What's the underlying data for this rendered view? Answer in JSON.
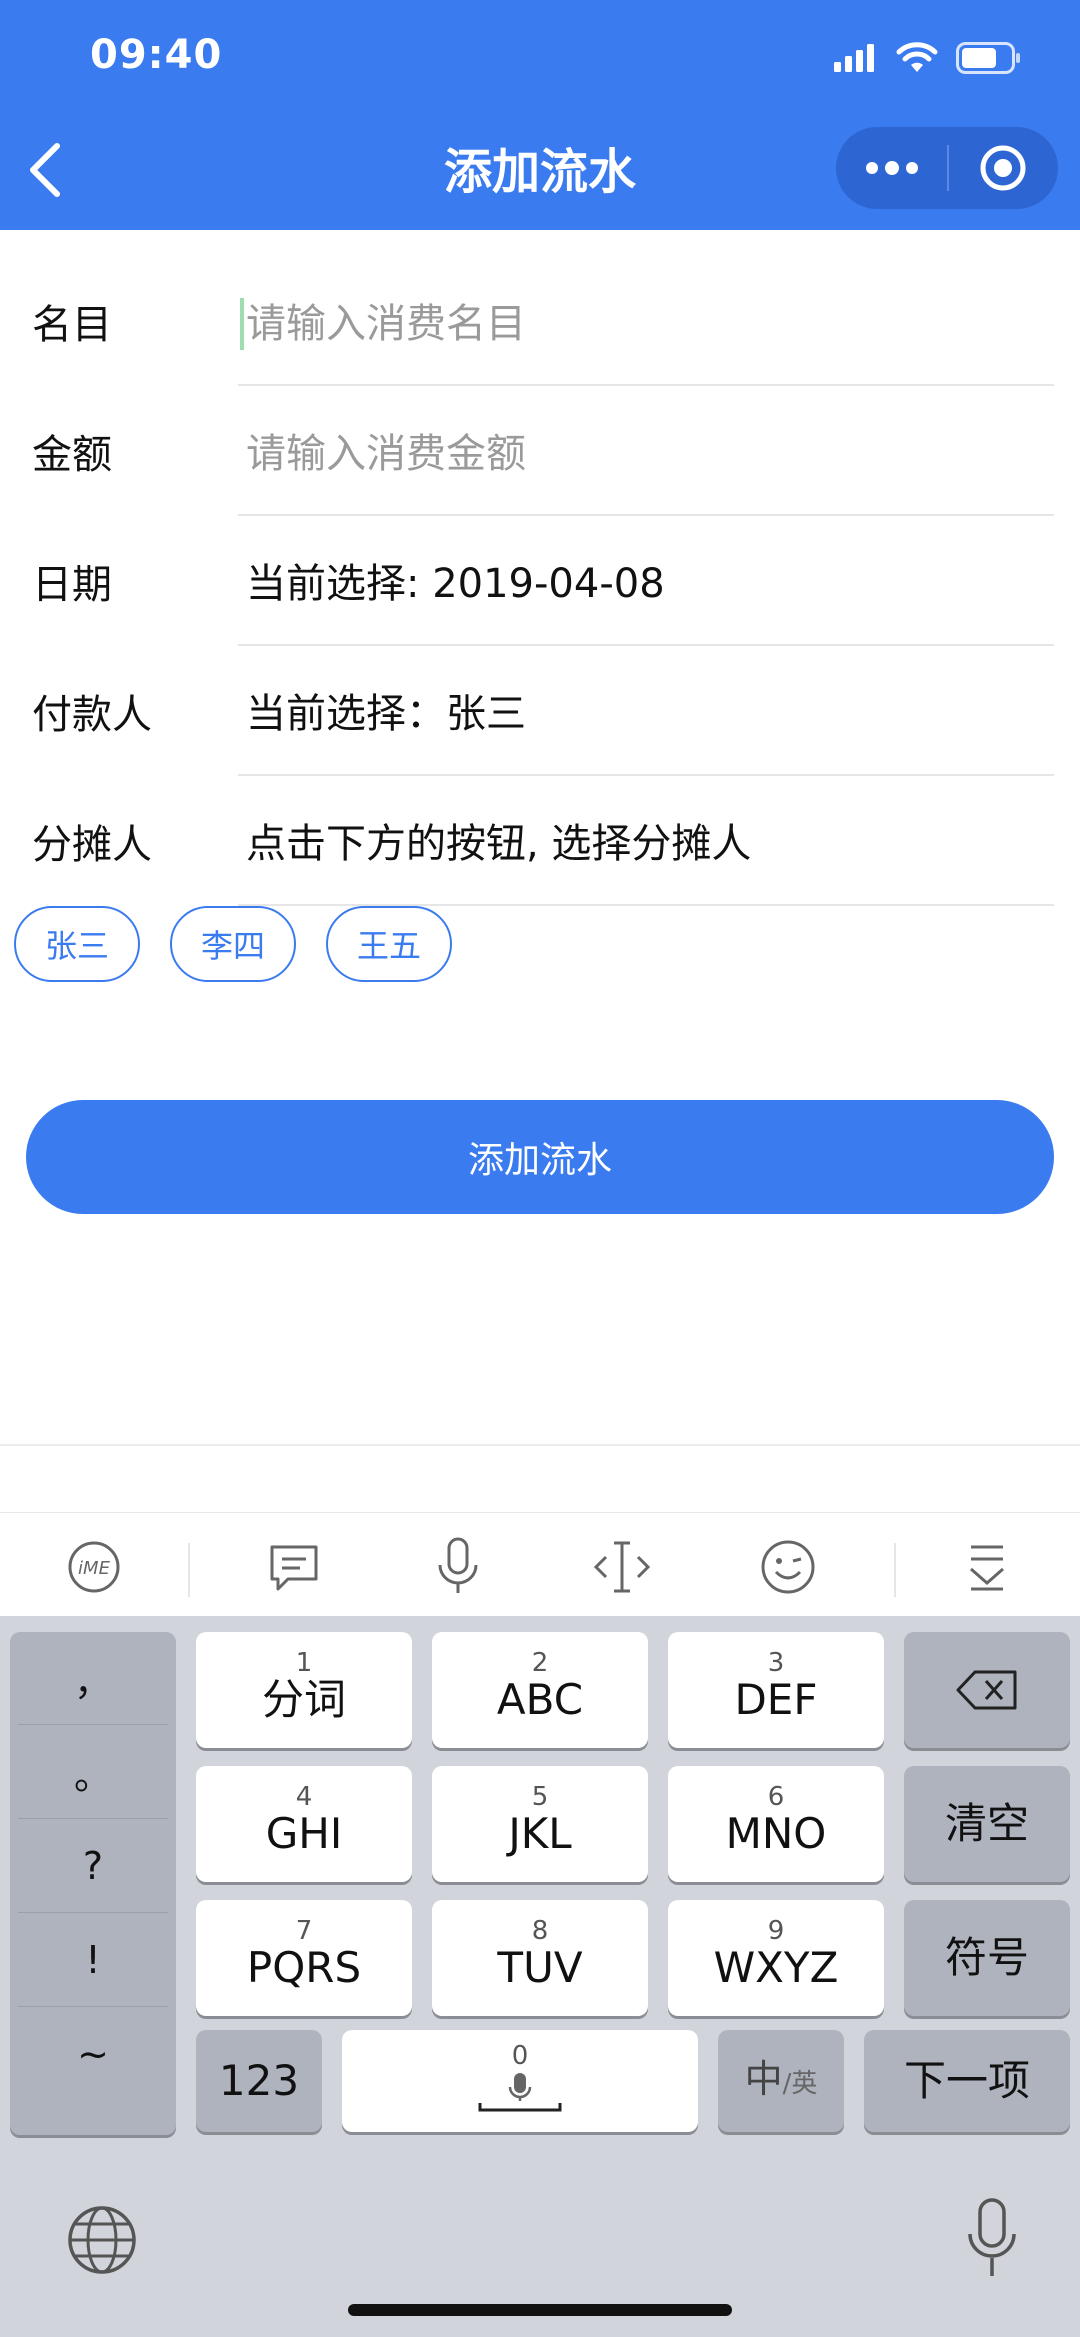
{
  "status_bar": {
    "time": "09:40"
  },
  "nav": {
    "title": "添加流水"
  },
  "form": {
    "name_label": "名目",
    "name_placeholder": "请输入消费名目",
    "amount_label": "金额",
    "amount_placeholder": "请输入消费金额",
    "date_label": "日期",
    "date_value": "当前选择: 2019-04-08",
    "payer_label": "付款人",
    "payer_value": "当前选择：张三",
    "sharer_label": "分摊人",
    "sharer_hint": "点击下方的按钮, 选择分摊人",
    "sharer_chips": [
      "张三",
      "李四",
      "王五"
    ],
    "submit_label": "添加流水"
  },
  "ime_toolbar": {
    "icons": [
      "ime-logo-icon",
      "chat-icon",
      "microphone-icon",
      "cursor-move-icon",
      "emoji-icon",
      "collapse-keyboard-icon"
    ]
  },
  "keyboard": {
    "punctuation": [
      "，",
      "。",
      "?",
      "!",
      "~"
    ],
    "keys": [
      {
        "num": "1",
        "label": "分词"
      },
      {
        "num": "2",
        "label": "ABC"
      },
      {
        "num": "3",
        "label": "DEF"
      },
      {
        "num": "4",
        "label": "GHI"
      },
      {
        "num": "5",
        "label": "JKL"
      },
      {
        "num": "6",
        "label": "MNO"
      },
      {
        "num": "7",
        "label": "PQRS"
      },
      {
        "num": "8",
        "label": "TUV"
      },
      {
        "num": "9",
        "label": "WXYZ"
      }
    ],
    "clear_label": "清空",
    "symbols_label": "符号",
    "numbers_label": "123",
    "space_num": "0",
    "lang_main": "中",
    "lang_sub": "/英",
    "next_label": "下一项"
  },
  "colors": {
    "primary": "#3a7bf0",
    "keyboard_bg": "#d2d4db"
  }
}
